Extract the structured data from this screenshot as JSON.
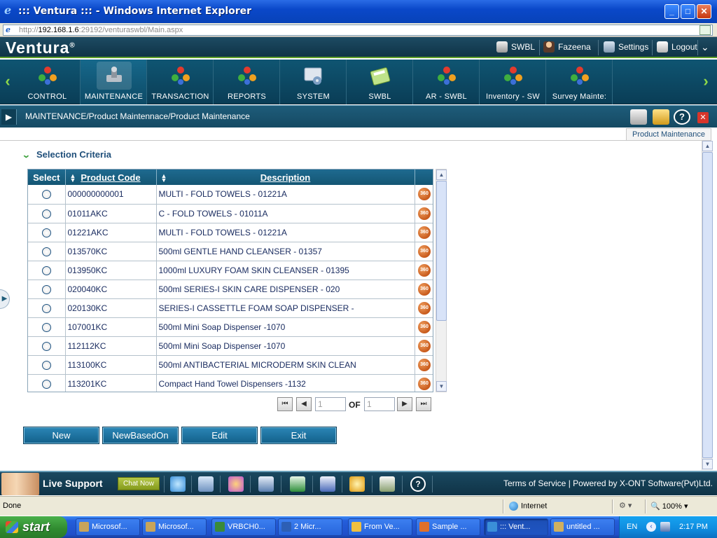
{
  "browser": {
    "title": "::: Ventura ::: - Windows Internet Explorer",
    "url_scheme": "http://",
    "url_host": "192.168.1.6",
    "url_rest": ":29192/venturaswbl/Main.aspx"
  },
  "header": {
    "logo": "Ventura",
    "logo_mark": "®",
    "links": {
      "company": "SWBL",
      "user": "Fazeena",
      "settings": "Settings",
      "logout": "Logout"
    }
  },
  "modules": [
    {
      "label": "CONTROL",
      "icon": "molecule-icon"
    },
    {
      "label": "MAINTENANCE",
      "icon": "wrench-icon"
    },
    {
      "label": "TRANSACTION",
      "icon": "molecule-icon"
    },
    {
      "label": "REPORTS",
      "icon": "molecule-icon"
    },
    {
      "label": "SYSTEM",
      "icon": "gears-icon"
    },
    {
      "label": "SWBL",
      "icon": "calculator-icon"
    },
    {
      "label": "AR - SWBL",
      "icon": "molecule-icon"
    },
    {
      "label": "Inventory - SW",
      "icon": "molecule-icon"
    },
    {
      "label": "Survey Mainte:",
      "icon": "molecule-icon"
    }
  ],
  "breadcrumb": "MAINTENANCE/Product Maintennace/Product Maintenance",
  "page_tab": "Product Maintenance",
  "selection_criteria": "Selection Criteria",
  "grid": {
    "headers": {
      "select": "Select",
      "code": "Product Code",
      "description": "Description"
    },
    "badge": "360",
    "rows": [
      {
        "code": "000000000001",
        "description": "MULTI - FOLD TOWELS - 01221A"
      },
      {
        "code": "01011AKC",
        "description": "C - FOLD TOWELS - 01011A"
      },
      {
        "code": "01221AKC",
        "description": "MULTI - FOLD TOWELS - 01221A"
      },
      {
        "code": "013570KC",
        "description": "500ml GENTLE HAND CLEANSER - 01357"
      },
      {
        "code": "013950KC",
        "description": "1000ml LUXURY FOAM SKIN CLEANSER - 01395"
      },
      {
        "code": "020040KC",
        "description": "500ml SERIES-I SKIN CARE DISPENSER - 020"
      },
      {
        "code": "020130KC",
        "description": "SERIES-I CASSETTLE FOAM SOAP DISPENSER -"
      },
      {
        "code": "107001KC",
        "description": "500ml Mini Soap Dispenser -1070"
      },
      {
        "code": "112112KC",
        "description": "500ml Mini Soap Dispenser -1070"
      },
      {
        "code": "113100KC",
        "description": "500ml ANTIBACTERIAL MICRODERM SKIN CLEAN"
      },
      {
        "code": "113201KC",
        "description": "Compact Hand Towel Dispensers -1132"
      }
    ]
  },
  "pager": {
    "current_page": "1",
    "of_label": "OF",
    "total_pages": "1"
  },
  "actions": {
    "new": "New",
    "new_based_on": "NewBasedOn",
    "edit": "Edit",
    "exit": "Exit"
  },
  "footer": {
    "live_support": "Live Support",
    "chat_now": "Chat Now",
    "links": "Terms of Service | Powered by X-ONT Software(Pvt)Ltd."
  },
  "statusbar": {
    "status": "Done",
    "zone": "Internet",
    "zoom": "100%"
  },
  "taskbar": {
    "start": "start",
    "tasks": [
      "Microsof...",
      "Microsof...",
      "VRBCH0...",
      "2 Micr...",
      "From Ve...",
      "Sample ...",
      "::: Vent...",
      "untitled ..."
    ],
    "language": "EN",
    "clock": "2:17 PM"
  }
}
